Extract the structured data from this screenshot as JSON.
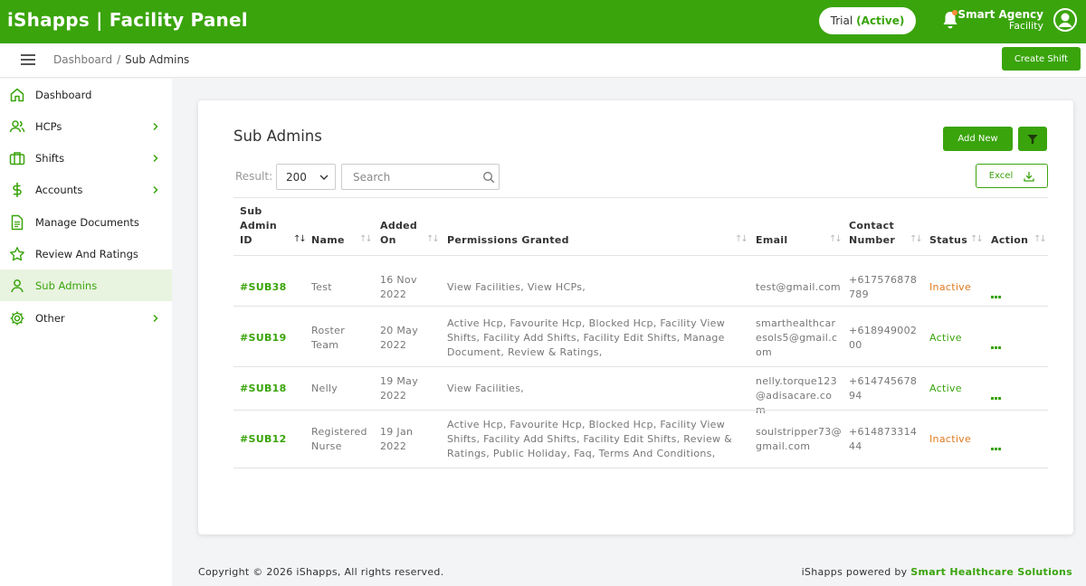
{
  "app": {
    "title": "iShapps | Facility Panel",
    "trial_label": "Trial",
    "trial_status": "(Active)",
    "user_name": "Smart Agency",
    "user_role": "Facility"
  },
  "subheader": {
    "breadcrumb_root": "Dashboard",
    "breadcrumb_sep": "/",
    "breadcrumb_current": "Sub Admins",
    "create_shift": "Create Shift"
  },
  "sidebar": {
    "items": [
      {
        "label": "Dashboard",
        "icon": "home-icon",
        "chevron": false,
        "active": false
      },
      {
        "label": "HCPs",
        "icon": "users-icon",
        "chevron": true,
        "active": false
      },
      {
        "label": "Shifts",
        "icon": "briefcase-icon",
        "chevron": true,
        "active": false
      },
      {
        "label": "Accounts",
        "icon": "dollar-icon",
        "chevron": true,
        "active": false
      },
      {
        "label": "Manage Documents",
        "icon": "document-icon",
        "chevron": false,
        "active": false
      },
      {
        "label": "Review And Ratings",
        "icon": "star-icon",
        "chevron": false,
        "active": false
      },
      {
        "label": "Sub Admins",
        "icon": "user-icon",
        "chevron": false,
        "active": true
      },
      {
        "label": "Other",
        "icon": "gear-icon",
        "chevron": true,
        "active": false
      }
    ]
  },
  "card": {
    "title": "Sub Admins",
    "add_new": "Add New",
    "result_label": "Result:",
    "result_value": "200",
    "search_placeholder": "Search",
    "excel": "Excel"
  },
  "table": {
    "headers": [
      "Sub Admin ID",
      "Name",
      "Added On",
      "Permissions Granted",
      "Email",
      "Contact Number",
      "Status",
      "Action"
    ],
    "rows": [
      {
        "id": "#SUB38",
        "name": "Test",
        "added_on": "16 Nov 2022",
        "permissions": "View Facilities, View HCPs,",
        "email": "test@gmail.com",
        "contact": "+617576878789",
        "status": "Inactive"
      },
      {
        "id": "#SUB19",
        "name": "Roster Team",
        "added_on": "20 May 2022",
        "permissions": "Active Hcp, Favourite Hcp, Blocked Hcp, Facility View Shifts, Facility Add Shifts, Facility Edit Shifts, Manage Document, Review & Ratings,",
        "email": "smarthealthcaresols5@gmail.com",
        "contact": "+61894900200",
        "status": "Active"
      },
      {
        "id": "#SUB18",
        "name": "Nelly",
        "added_on": "19 May 2022",
        "permissions": "View Facilities,",
        "email": "nelly.torque123@adisacare.com",
        "contact": "+61474567894",
        "status": "Active"
      },
      {
        "id": "#SUB12",
        "name": "Registered Nurse",
        "added_on": "19 Jan 2022",
        "permissions": "Active Hcp, Favourite Hcp, Blocked Hcp, Facility View Shifts, Facility Add Shifts, Facility Edit Shifts, Review & Ratings, Public Holiday, Faq, Terms And Conditions,",
        "email": "soulstripper73@gmail.com",
        "contact": "+61487331444",
        "status": "Inactive"
      }
    ]
  },
  "footer": {
    "copyright": "Copyright © 2026 iShapps, All rights reserved.",
    "powered_prefix": "iShapps powered by",
    "powered_brand": "Smart Healthcare Solutions"
  },
  "colors": {
    "brand_green": "#3aa40c",
    "inactive_orange": "#e07a1f"
  }
}
